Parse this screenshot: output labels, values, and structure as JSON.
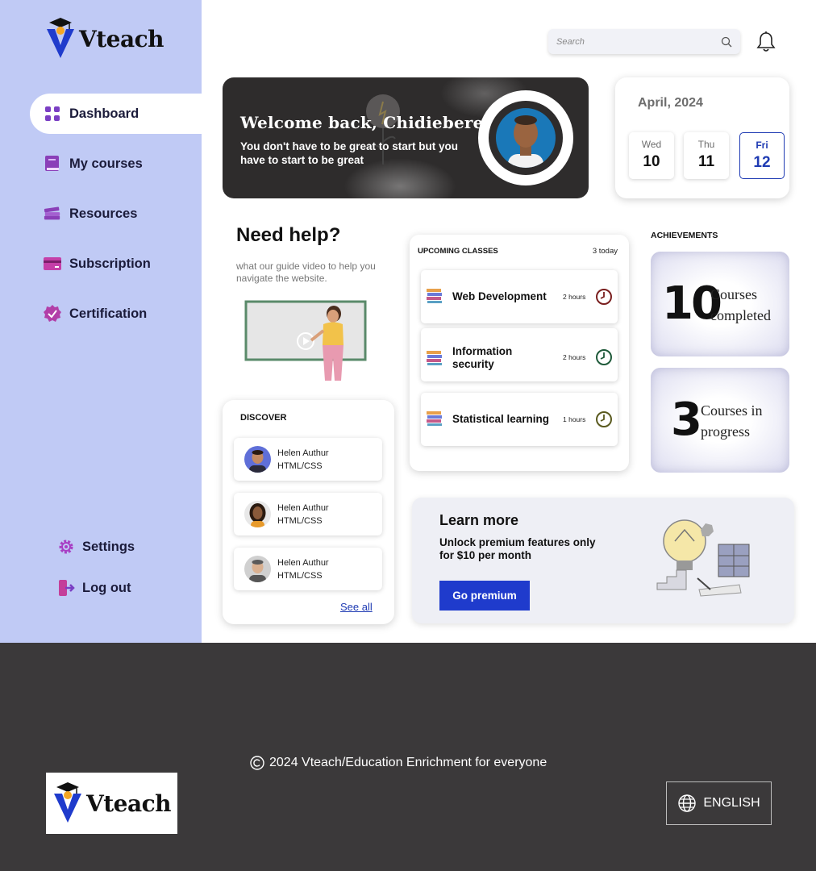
{
  "brand": {
    "name": "Vteach",
    "accent": "#1f3bcc",
    "sidebar_bg": "#c0caf5"
  },
  "sidebar": {
    "items": [
      {
        "label": "Dashboard",
        "icon": "dashboard-grid-icon",
        "active": true
      },
      {
        "label": "My courses",
        "icon": "book-icon"
      },
      {
        "label": "Resources",
        "icon": "books-stack-icon"
      },
      {
        "label": "Subscription",
        "icon": "card-icon"
      },
      {
        "label": "Certification",
        "icon": "badge-check-icon"
      }
    ],
    "bottom": [
      {
        "label": "Settings",
        "icon": "gear-icon"
      },
      {
        "label": "Log out",
        "icon": "logout-icon"
      }
    ]
  },
  "search": {
    "placeholder": "Search"
  },
  "welcome": {
    "title": "Welcome back, Chidiebere!",
    "subtitle": "You don't have to be great to start but you have to start to be great"
  },
  "calendar": {
    "month": "April, 2024",
    "days": [
      {
        "name": "Wed",
        "date": "10"
      },
      {
        "name": "Thu",
        "date": "11"
      },
      {
        "name": "Fri",
        "date": "12",
        "selected": true
      }
    ]
  },
  "help": {
    "title": "Need help?",
    "subtitle": "what our guide video to help you navigate the website."
  },
  "discover": {
    "title": "DISCOVER",
    "mentors": [
      {
        "name": "Helen Authur",
        "topic": "HTML/CSS"
      },
      {
        "name": "Helen Authur",
        "topic": "HTML/CSS"
      },
      {
        "name": "Helen Authur",
        "topic": "HTML/CSS"
      }
    ],
    "see_all": "See all"
  },
  "upcoming": {
    "title": "UPCOMING CLASSES",
    "count": "3 today",
    "classes": [
      {
        "name": "Web Development",
        "duration": "2 hours",
        "clock_color": "#7a1f1f"
      },
      {
        "name": "Information security",
        "duration": "2 hours",
        "clock_color": "#1f5a3a"
      },
      {
        "name": "Statistical learning",
        "duration": "1 hours",
        "clock_color": "#5a5a1f"
      }
    ]
  },
  "achievements": {
    "title": "ACHIEVEMENTS",
    "items": [
      {
        "number": "10",
        "label": "Courses completed"
      },
      {
        "number": "3",
        "label": "Courses in progress"
      }
    ]
  },
  "learn_more": {
    "title": "Learn more",
    "subtitle": "Unlock premium features only for $10 per month",
    "button": "Go premium"
  },
  "footer": {
    "copyright": "2024 Vteach/Education Enrichment for everyone",
    "language": "ENGLISH",
    "bg": "#3b393a"
  }
}
